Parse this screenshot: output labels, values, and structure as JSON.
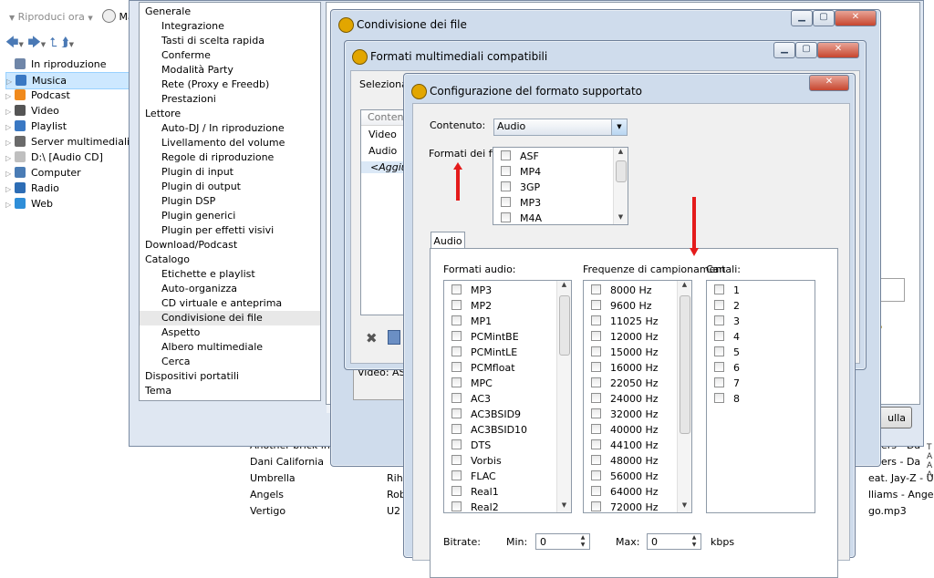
{
  "toolbar": {
    "play_label": "Riproduci ora",
    "extra_label": "Ma"
  },
  "nav": {
    "items": [
      {
        "label": "In riproduzione",
        "icon": "now-playing-icon",
        "color": "#6f86a8"
      },
      {
        "label": "Musica",
        "icon": "music-note-icon",
        "color": "#3a78c3"
      },
      {
        "label": "Podcast",
        "icon": "podcast-icon",
        "color": "#f08a1d"
      },
      {
        "label": "Video",
        "icon": "video-icon",
        "color": "#555555"
      },
      {
        "label": "Playlist",
        "icon": "playlist-icon",
        "color": "#3a78c3"
      },
      {
        "label": "Server multimediali",
        "icon": "server-icon",
        "color": "#6a6a6a"
      },
      {
        "label": "D:\\ [Audio CD]",
        "icon": "cd-icon",
        "color": "#bfbfbf"
      },
      {
        "label": "Computer",
        "icon": "computer-icon",
        "color": "#4a7cb5"
      },
      {
        "label": "Radio",
        "icon": "radio-icon",
        "color": "#2d6db5"
      },
      {
        "label": "Web",
        "icon": "globe-icon",
        "color": "#2f8ed8"
      }
    ]
  },
  "options": {
    "items": [
      {
        "label": "Generale",
        "level": 0
      },
      {
        "label": "Integrazione",
        "level": 1
      },
      {
        "label": "Tasti di scelta rapida",
        "level": 1
      },
      {
        "label": "Conferme",
        "level": 1
      },
      {
        "label": "Modalità Party",
        "level": 1
      },
      {
        "label": "Rete (Proxy e Freedb)",
        "level": 1
      },
      {
        "label": "Prestazioni",
        "level": 1
      },
      {
        "label": "Lettore",
        "level": 0
      },
      {
        "label": "Auto-DJ / In riproduzione",
        "level": 1
      },
      {
        "label": "Livellamento del volume",
        "level": 1
      },
      {
        "label": "Regole di riproduzione",
        "level": 1
      },
      {
        "label": "Plugin di input",
        "level": 1
      },
      {
        "label": "Plugin di output",
        "level": 1
      },
      {
        "label": "Plugin DSP",
        "level": 1
      },
      {
        "label": "Plugin generici",
        "level": 1
      },
      {
        "label": "Plugin per effetti visivi",
        "level": 1
      },
      {
        "label": "Download/Podcast",
        "level": 0
      },
      {
        "label": "Catalogo",
        "level": 0
      },
      {
        "label": "Etichette e playlist",
        "level": 1
      },
      {
        "label": "Auto-organizza",
        "level": 1
      },
      {
        "label": "CD virtuale e anteprima",
        "level": 1
      },
      {
        "label": "Condivisione dei file",
        "level": 1
      },
      {
        "label": "Aspetto",
        "level": 1
      },
      {
        "label": "Albero multimediale",
        "level": 1
      },
      {
        "label": "Cerca",
        "level": 1
      },
      {
        "label": "Dispositivi portatili",
        "level": 0
      },
      {
        "label": "Tema",
        "level": 0
      }
    ],
    "selected_index": 21
  },
  "dialog_share": {
    "title": "Condivisione dei file",
    "bottom_text": "Video: ASF",
    "button_partial": "ulla"
  },
  "dialog_formats": {
    "title": "Formati multimediali compatibili",
    "select_label": "Seleziona",
    "list_header": "Conten",
    "list_items": [
      "Video",
      "Audio",
      "<Aggiu"
    ]
  },
  "dialog_config": {
    "title": "Configurazione del formato supportato",
    "content_label": "Contenuto:",
    "content_value": "Audio",
    "file_formats_label": "Formati dei file",
    "file_formats": [
      "ASF",
      "MP4",
      "3GP",
      "MP3",
      "M4A"
    ],
    "tab_label": "Audio",
    "audio_formats_label": "Formati audio:",
    "audio_formats": [
      "MP3",
      "MP2",
      "MP1",
      "PCMintBE",
      "PCMintLE",
      "PCMfloat",
      "MPC",
      "AC3",
      "AC3BSID9",
      "AC3BSID10",
      "DTS",
      "Vorbis",
      "FLAC",
      "Real1",
      "Real2"
    ],
    "sample_rates_label": "Frequenze di campionament",
    "sample_rates": [
      "8000 Hz",
      "9600 Hz",
      "11025 Hz",
      "12000 Hz",
      "15000 Hz",
      "16000 Hz",
      "22050 Hz",
      "24000 Hz",
      "32000 Hz",
      "40000 Hz",
      "44100 Hz",
      "48000 Hz",
      "56000 Hz",
      "64000 Hz",
      "72000 Hz"
    ],
    "channels_label": "Canali:",
    "channels": [
      "1",
      "2",
      "3",
      "4",
      "5",
      "6",
      "7",
      "8"
    ],
    "bitrate_label": "Bitrate:",
    "min_label": "Min:",
    "min_value": "0",
    "max_label": "Max:",
    "max_value": "0",
    "unit_label": "kbps"
  },
  "tracks": {
    "rows": [
      {
        "title": "Another brick in th",
        "artist": "",
        "right": "ppers - Da"
      },
      {
        "title": "Dani California",
        "artist": "",
        "right": "ppers - Da"
      },
      {
        "title": "Umbrella",
        "artist": "Riha",
        "right": "eat. Jay-Z - Umb"
      },
      {
        "title": "Angels",
        "artist": "Rob",
        "right": "lliams - Angels.m"
      },
      {
        "title": "Vertigo",
        "artist": "U2",
        "right": "go.mp3"
      }
    ]
  },
  "colors": {
    "arrow": "#e41b1b",
    "selection": "#cde8ff"
  }
}
